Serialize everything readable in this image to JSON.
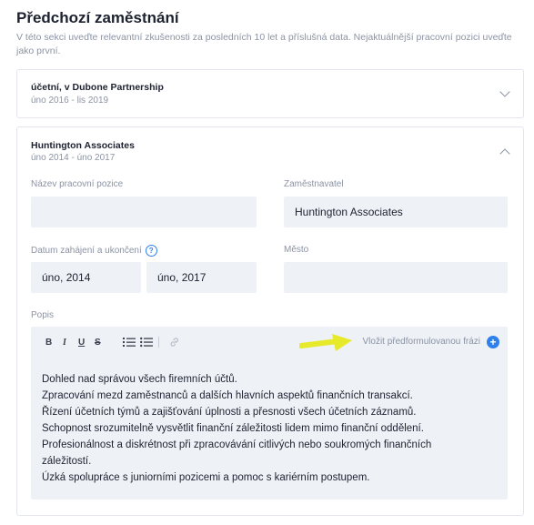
{
  "section": {
    "title": "Předchozí zaměstnání",
    "subtitle": "V této sekci uveďte relevantní zkušenosti za posledních 10 let a příslušná data. Nejaktuálnější pracovní pozici uveďte jako první."
  },
  "jobs": [
    {
      "title": "účetní, v Dubone Partnership",
      "dates": "úno 2016 - lis 2019"
    },
    {
      "title": "Huntington Associates",
      "dates": "úno 2014 - úno 2017"
    }
  ],
  "form": {
    "position_label": "Název pracovní pozice",
    "position_value": "",
    "employer_label": "Zaměstnavatel",
    "employer_value": "Huntington Associates",
    "dates_label": "Datum zahájení a ukončení",
    "help_icon": "?",
    "start_value": "úno, 2014",
    "end_value": "úno, 2017",
    "city_label": "Město",
    "city_value": "",
    "desc_label": "Popis"
  },
  "editor": {
    "toolbar": {
      "bold": "B",
      "italic": "I",
      "underline": "U",
      "strike": "S"
    },
    "insert_phrase": "Vložit předformulovanou frázi",
    "plus": "+",
    "lines": [
      " Dohled nad správou všech firemních účtů.",
      " Zpracování mezd zaměstnanců a dalších hlavních aspektů finančních transakcí.",
      "   Řízení účetních týmů a zajišťování úplnosti a přesnosti všech účetních záznamů.",
      "Schopnost srozumitelně vysvětlit finanční záležitosti lidem mimo finanční oddělení.",
      "Profesionálnost a diskrétnost při zpracovávání citlivých nebo soukromých finančních",
      "záležitostí.",
      " Úzká spolupráce s juniorními pozicemi a pomoc s kariérním postupem."
    ]
  },
  "colors": {
    "accent": "#2f80ed",
    "field_bg": "#eef1f6",
    "highlight_arrow": "#e7ea2a"
  },
  "icons": [
    "chevron-down-icon",
    "chevron-up-icon",
    "help-icon",
    "numbered-list-icon",
    "bullet-list-icon",
    "link-icon",
    "plus-circle-icon",
    "arrow-annotation"
  ]
}
